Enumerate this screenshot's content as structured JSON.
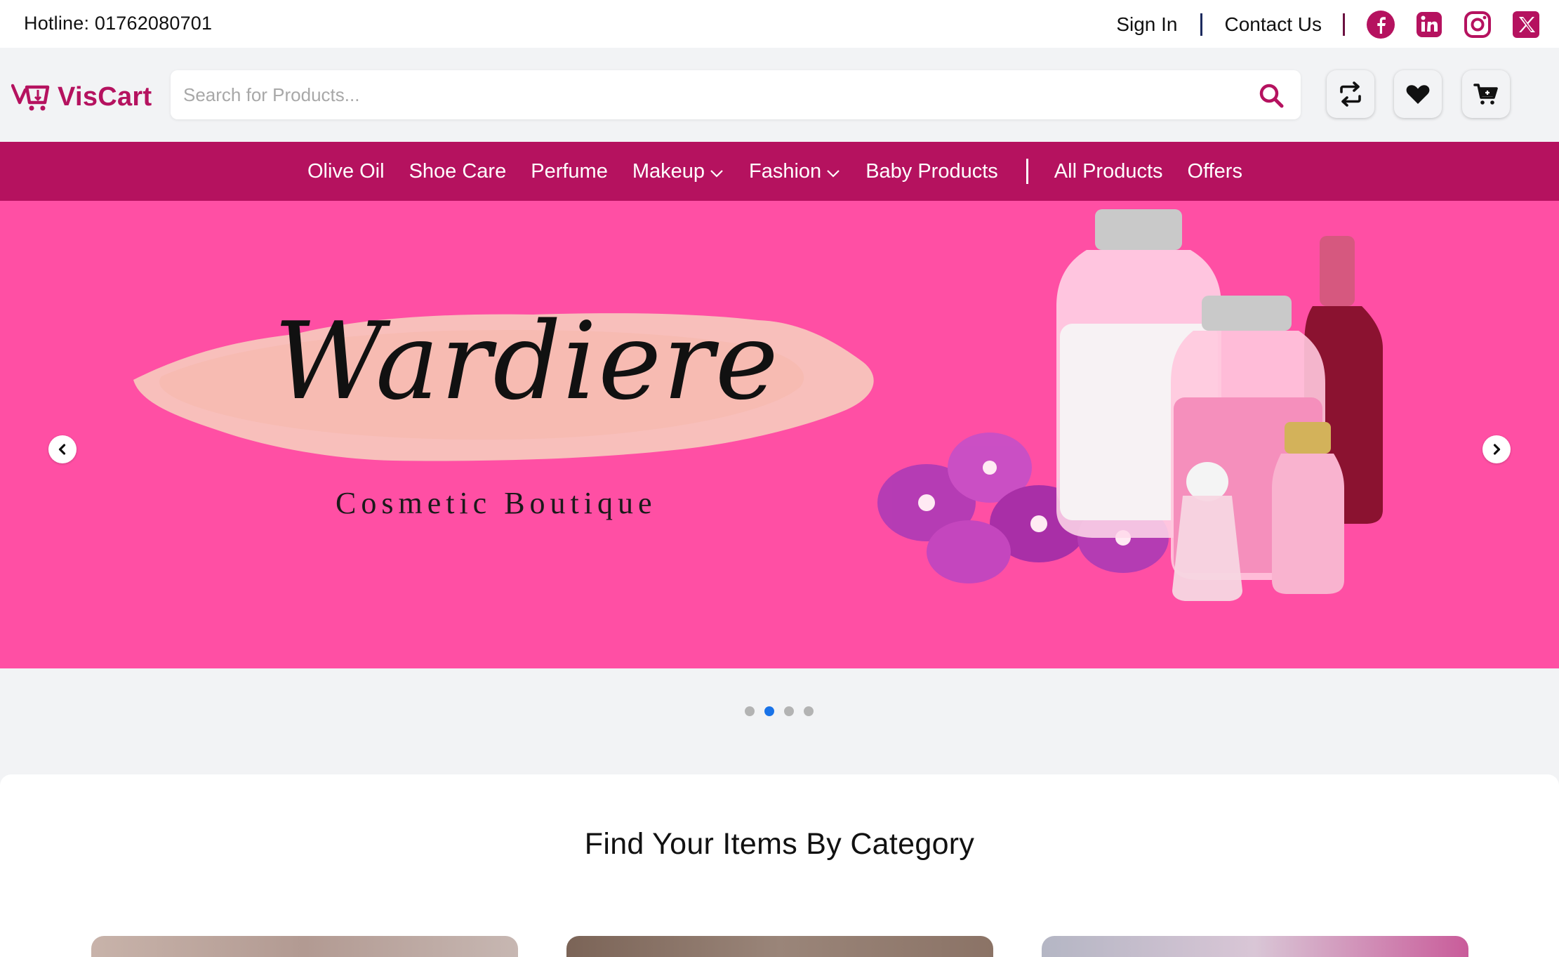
{
  "topbar": {
    "hotline": "Hotline: 01762080701",
    "sign_in": "Sign In",
    "contact_us": "Contact Us",
    "social": [
      {
        "name": "facebook-icon",
        "color": "#b5125f"
      },
      {
        "name": "linkedin-icon",
        "color": "#b5125f"
      },
      {
        "name": "instagram-icon",
        "color": "#b5125f"
      },
      {
        "name": "x-icon",
        "color": "#b5125f"
      }
    ]
  },
  "header": {
    "logo_text": "VisCart",
    "search_placeholder": "Search for Products...",
    "buttons": [
      "compare-icon",
      "wishlist-heart-icon",
      "cart-icon"
    ]
  },
  "nav": {
    "items": [
      {
        "label": "Olive Oil",
        "dropdown": false
      },
      {
        "label": "Shoe Care",
        "dropdown": false
      },
      {
        "label": "Perfume",
        "dropdown": false
      },
      {
        "label": "Makeup",
        "dropdown": true
      },
      {
        "label": "Fashion",
        "dropdown": true
      },
      {
        "label": "Baby Products",
        "dropdown": false
      }
    ],
    "extra_items": [
      {
        "label": "All Products"
      },
      {
        "label": "Offers"
      }
    ]
  },
  "hero": {
    "title": "Wardiere",
    "subtitle": "Cosmetic Boutique",
    "background": "#ff4fa4"
  },
  "carousel": {
    "dot_count": 4,
    "active_dot": 2
  },
  "category": {
    "title": "Find Your Items By Category"
  },
  "colors": {
    "brand": "#b5125f",
    "hero_pink": "#ff4fa4",
    "page_bg": "#f2f3f5",
    "active_dot": "#1a73e8"
  }
}
